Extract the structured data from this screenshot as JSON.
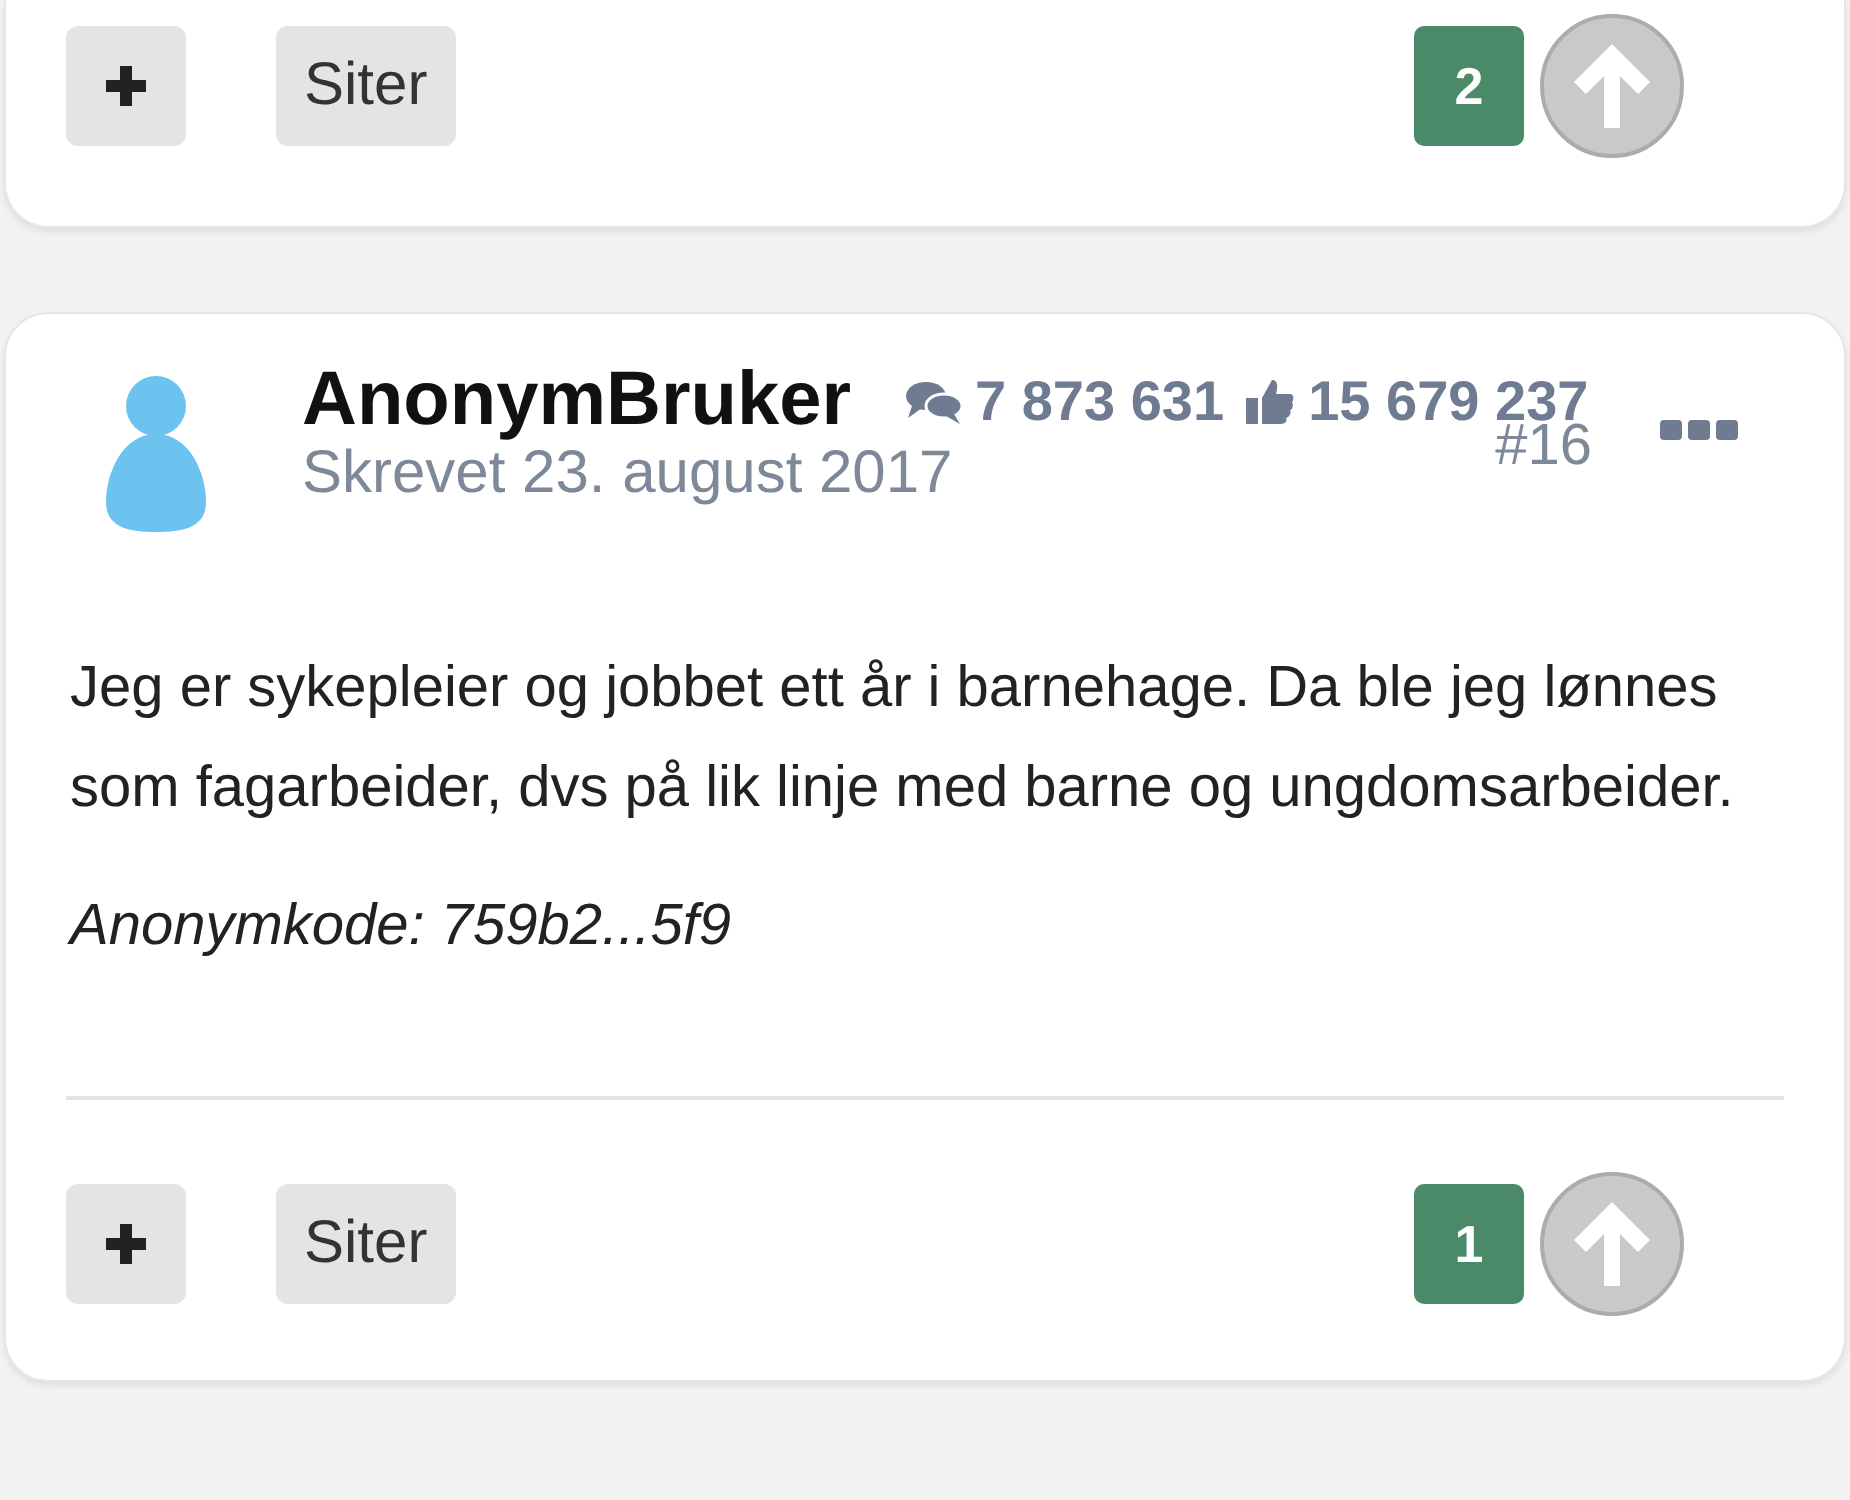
{
  "previous_post": {
    "quote_label": "Siter",
    "score": "2"
  },
  "post": {
    "author": "AnonymBruker",
    "post_count": "7 873 631",
    "likes": "15 679 237",
    "date": "Skrevet 23. august 2017",
    "number": "#16",
    "body": "Jeg er sykepleier og jobbet ett år i barnehage. Da ble jeg lønnes som fagarbeider, dvs på lik linje med barne og ungdomsarbeider.",
    "anon_code": "Anonymkode: 759b2...5f9",
    "quote_label": "Siter",
    "score": "1"
  }
}
